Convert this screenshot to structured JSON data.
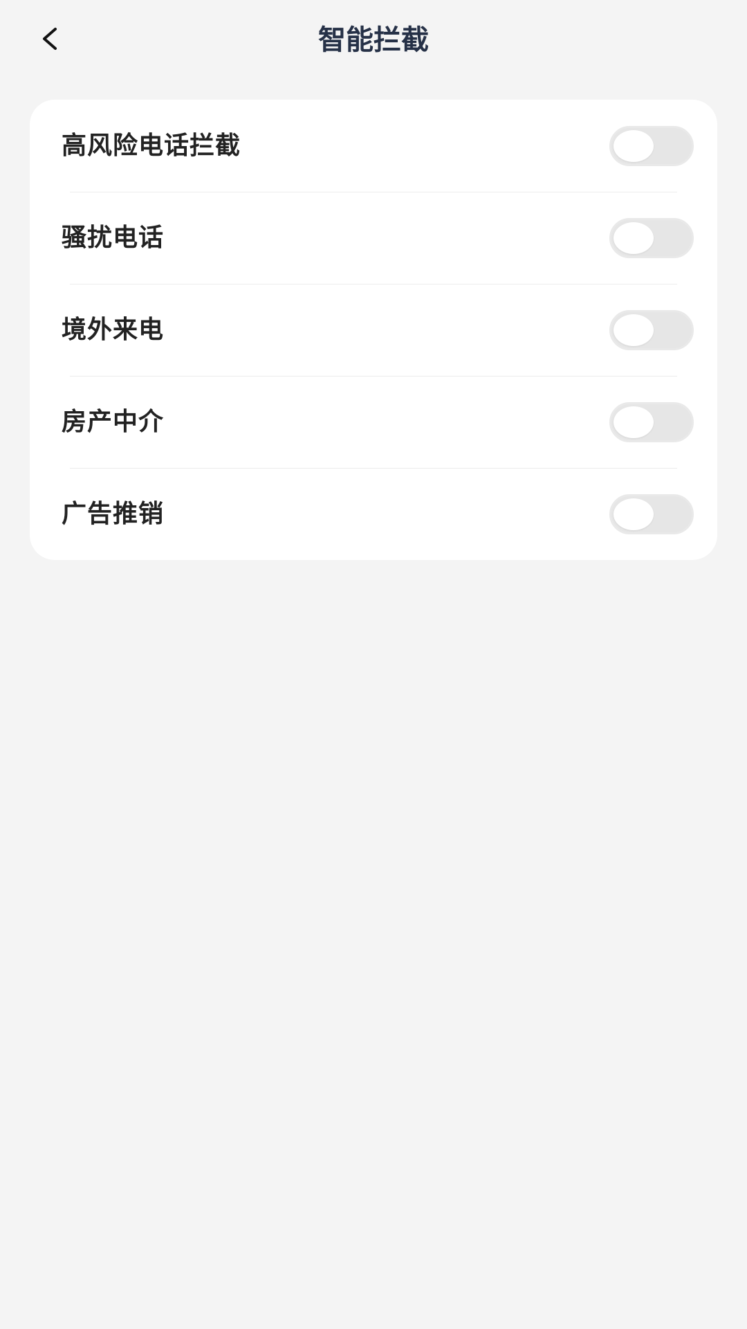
{
  "header": {
    "back_icon": "chevron-left-icon",
    "title": "智能拦截"
  },
  "settings": {
    "items": [
      {
        "label": "高风险电话拦截",
        "enabled": false
      },
      {
        "label": "骚扰电话",
        "enabled": false
      },
      {
        "label": "境外来电",
        "enabled": false
      },
      {
        "label": "房产中介",
        "enabled": false
      },
      {
        "label": "广告推销",
        "enabled": false
      }
    ]
  },
  "colors": {
    "background": "#f4f4f4",
    "card": "#ffffff",
    "title": "#263147",
    "label": "#222222",
    "toggle_off": "#e6e6e6"
  }
}
